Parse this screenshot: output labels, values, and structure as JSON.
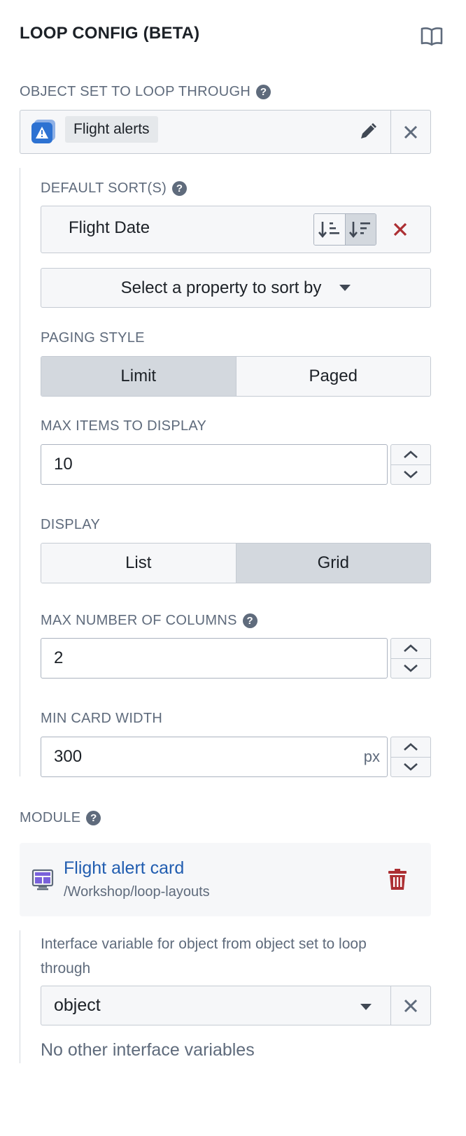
{
  "header": {
    "title": "LOOP CONFIG (BETA)",
    "docs_icon": "book-icon"
  },
  "object_set": {
    "label": "OBJECT SET TO LOOP THROUGH",
    "value": "Flight alerts",
    "object_icon": "warning-icon",
    "edit_icon": "edit-icon",
    "clear_icon": "close-icon"
  },
  "sorts": {
    "label": "DEFAULT SORT(S)",
    "items": [
      {
        "property": "Flight Date",
        "direction": "descending"
      }
    ],
    "add_placeholder": "Select a property to sort by"
  },
  "paging": {
    "label": "PAGING STYLE",
    "options": [
      "Limit",
      "Paged"
    ],
    "selected": "Limit"
  },
  "max_items": {
    "label": "MAX ITEMS TO DISPLAY",
    "value": "10"
  },
  "display": {
    "label": "DISPLAY",
    "options": [
      "List",
      "Grid"
    ],
    "selected": "Grid"
  },
  "max_columns": {
    "label": "MAX NUMBER OF COLUMNS",
    "value": "2"
  },
  "min_card_width": {
    "label": "MIN CARD WIDTH",
    "value": "300",
    "unit": "px"
  },
  "module": {
    "label": "MODULE",
    "name": "Flight alert card",
    "path": "/Workshop/loop-layouts",
    "icon": "layout-icon",
    "delete_icon": "trash-icon"
  },
  "interface": {
    "description": "Interface variable for object from object set to loop through",
    "selected": "object",
    "empty_text": "No other interface variables"
  },
  "colors": {
    "accent_blue": "#215db0",
    "danger_red": "#ac2f33",
    "muted": "#5f6b7c"
  }
}
